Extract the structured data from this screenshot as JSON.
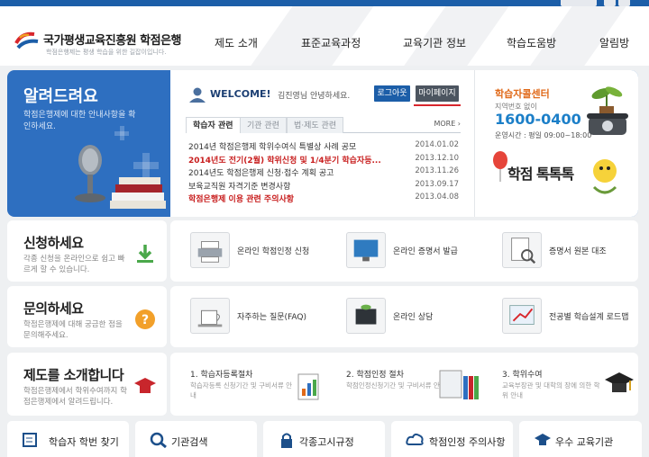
{
  "header": {
    "logo_title": "국가평생교육진흥원 학점은행",
    "logo_sub": "학점은행제는 평생 학습을 위한 길잡이입니다.",
    "nav": [
      "제도 소개",
      "표준교육과정",
      "교육기관 정보",
      "학습도움방",
      "알림방"
    ]
  },
  "notice": {
    "title": "알려드려요",
    "desc": "학점은행제에 대한 안내사항을 확인하세요."
  },
  "welcome": {
    "label": "WELCOME!",
    "user_text": "김진영님 안녕하세요.",
    "logout_label": "로그아웃",
    "mypage_label": "마이페이지"
  },
  "tabs": [
    "학습자 관련",
    "기관 관련",
    "법·제도 관련"
  ],
  "more_label": "MORE",
  "notices": [
    {
      "title": "2014년 학점은행제 학위수여식 특별상 사례 공모",
      "date": "2014.01.02"
    },
    {
      "title": "2014년도 전기(2월) 학위신청 및 1/4분기 학습자등...",
      "date": "2013.12.10"
    },
    {
      "title": "2014년도 학점은행제 신청·접수 계획 공고",
      "date": "2013.11.26"
    },
    {
      "title": "보육교직원 자격기준 변경사항",
      "date": "2013.09.17"
    },
    {
      "title": "학점은행제 이용 관련 주의사항",
      "date": "2013.04.08"
    }
  ],
  "callcenter": {
    "title": "학습자콜센터",
    "sub": "지역번호 없이",
    "number": "1600-0400",
    "hours": "운영시간 : 평일 09:00~18:00"
  },
  "banner_text": "학점 톡톡톡",
  "sections": {
    "apply": {
      "title": "신청하세요",
      "desc": "각종 신청을 온라인으로 쉽고 빠르게 할 수 있습니다.",
      "items": [
        "온라인 학점인정 신청",
        "온라인 증명서 발급",
        "증명서 원본 대조"
      ]
    },
    "ask": {
      "title": "문의하세요",
      "desc": "학점은행제에 대해 궁금한 점을 문의해주세요.",
      "items": [
        "자주하는 질문(FAQ)",
        "온라인 상담",
        "전공별 학습설계 로드맵"
      ]
    },
    "intro": {
      "title": "제도를 소개합니다",
      "desc": "학점은행제에서 학위수여까지 학점은행제에서 알려드립니다.",
      "steps": [
        {
          "title": "1. 학습자등록절차",
          "desc": "학습자등록 신청기간 및 구비서류 안내"
        },
        {
          "title": "2. 학점인정 절차",
          "desc": "학점인정신청기간 및 구비서류 안내"
        },
        {
          "title": "3. 학위수여",
          "desc": "교육부장관 및 대학의 장에 의한 학위 안내"
        }
      ]
    }
  },
  "bottom_links": [
    "학습자 학번 찾기",
    "기관검색",
    "각종고시규정",
    "학점인정 주의사항",
    "우수 교육기관"
  ],
  "colors": {
    "brand_blue": "#2e6fc0",
    "accent_orange": "#e06a1a",
    "alert_red": "#c81e1e"
  }
}
